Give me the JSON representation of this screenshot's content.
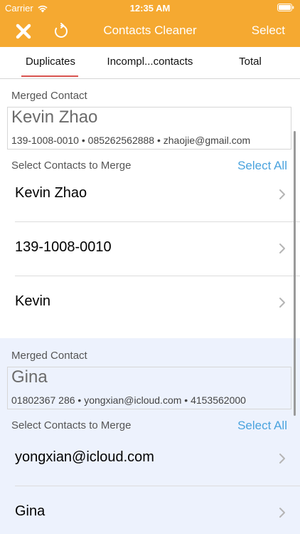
{
  "status_bar": {
    "carrier": "Carrier",
    "time": "12:35 AM"
  },
  "nav": {
    "title": "Contacts Cleaner",
    "select_label": "Select"
  },
  "tabs": [
    {
      "label": "Duplicates",
      "active": true
    },
    {
      "label": "Incompl...contacts",
      "active": false
    },
    {
      "label": "Total",
      "active": false
    }
  ],
  "groups": [
    {
      "merged_label": "Merged Contact",
      "merged_name": "Kevin Zhao",
      "merged_detail": "139-1008-0010 • 085262562888 • zhaojie@gmail.com",
      "merge_label": "Select Contacts to Merge",
      "select_all_label": "Select All",
      "contacts": [
        "Kevin Zhao",
        "139-1008-0010",
        "Kevin"
      ]
    },
    {
      "merged_label": "Merged Contact",
      "merged_name": "Gina",
      "merged_detail": "01802367 286 • yongxian@icloud.com • 4153562000",
      "merge_label": "Select Contacts to Merge",
      "select_all_label": "Select All",
      "contacts": [
        "yongxian@icloud.com",
        "Gina"
      ]
    }
  ],
  "colors": {
    "header": "#f5a931",
    "accent_link": "#4aa3de",
    "tab_indicator": "#d9534f",
    "group_highlight": "#edf2fd"
  }
}
